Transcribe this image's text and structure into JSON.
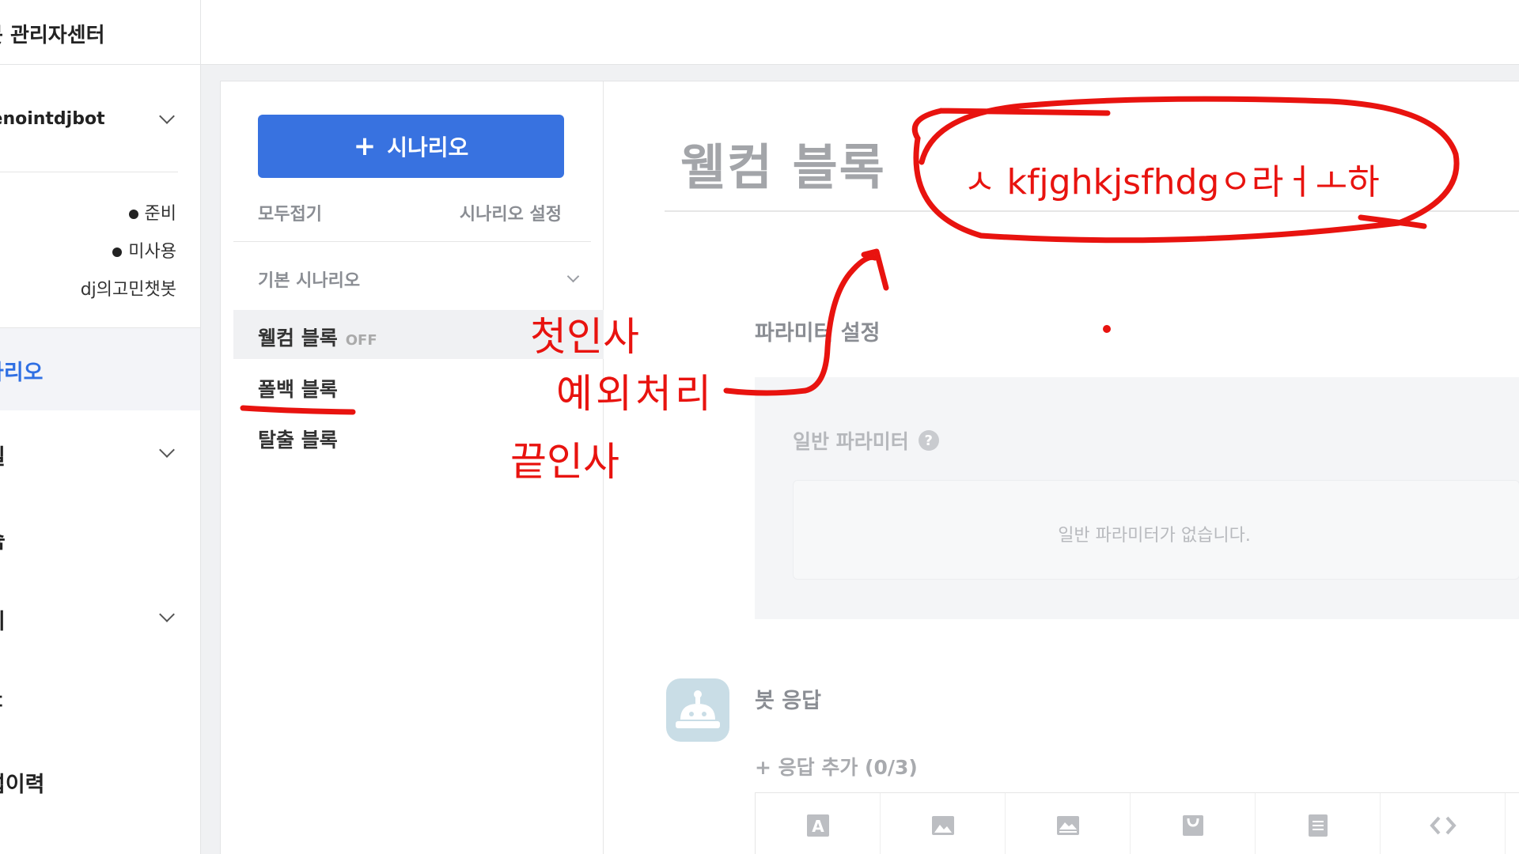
{
  "app": {
    "title": "봇 관리자센터"
  },
  "nav": {
    "bot_name": "tenointdjbot",
    "status": [
      "준비",
      "미사용",
      "dj의고민챗봇"
    ],
    "active_item": "나리오",
    "items": [
      "릴",
      "슘",
      "취",
      "ㄷ",
      "섭이력"
    ]
  },
  "scenario_panel": {
    "add_button": "시나리오",
    "collapse_all": "모두접기",
    "scenario_settings": "시나리오 설정",
    "group": "기본 시나리오",
    "blocks": [
      {
        "label": "웰컴 블록",
        "badge": "OFF"
      },
      {
        "label": "폴백 블록"
      },
      {
        "label": "탈출 블록"
      }
    ]
  },
  "editor": {
    "block_title": "웰컴 블록",
    "param_section": "파라미터 설정",
    "general_params": "일반 파라미터",
    "help_glyph": "?",
    "no_params": "일반 파라미터가 없습니다.",
    "bot_response": "봇 응답",
    "add_response": "+ 응답 추가 (0/3)",
    "response_types": [
      "text-icon",
      "image-icon",
      "card-icon",
      "commerce-icon",
      "list-icon",
      "code-icon"
    ]
  },
  "annotations": {
    "circle_text": "ㅅ kfjghkjsfhdgㅇ라ㅓㅗ하",
    "first_greeting": "첫인사",
    "exception": "예외처리",
    "end_greeting": "끝인사",
    "ink_color": "#e8130f"
  }
}
